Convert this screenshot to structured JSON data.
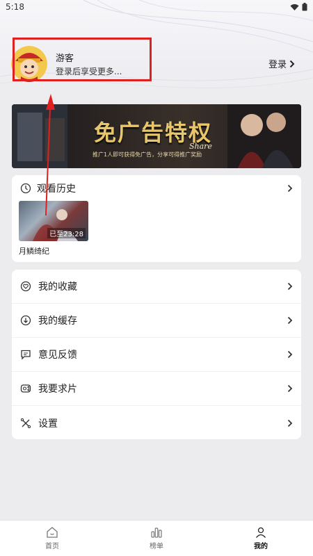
{
  "status_bar": {
    "time": "5:18"
  },
  "profile": {
    "name": "游客",
    "subtitle": "登录后享受更多...",
    "login_label": "登录"
  },
  "banner": {
    "title": "免广告特权",
    "script": "Share",
    "sub": "推广1人即可获得免广告，分享可得推广奖励"
  },
  "history": {
    "title": "观看历史",
    "items": [
      {
        "title": "月鳞绮纪",
        "progress_label": "已至23:28"
      }
    ]
  },
  "menu": [
    {
      "label": "我的收藏",
      "icon": "heart-icon"
    },
    {
      "label": "我的缓存",
      "icon": "download-icon"
    },
    {
      "label": "意见反馈",
      "icon": "feedback-icon"
    },
    {
      "label": "我要求片",
      "icon": "video-request-icon"
    },
    {
      "label": "设置",
      "icon": "settings-icon"
    }
  ],
  "tabs": [
    {
      "label": "首页",
      "icon": "home-icon",
      "active": false
    },
    {
      "label": "榜单",
      "icon": "ranking-icon",
      "active": false
    },
    {
      "label": "我的",
      "icon": "person-icon",
      "active": true
    }
  ],
  "colors": {
    "highlight": "#e02020",
    "banner_gold": "#e8c66a"
  }
}
